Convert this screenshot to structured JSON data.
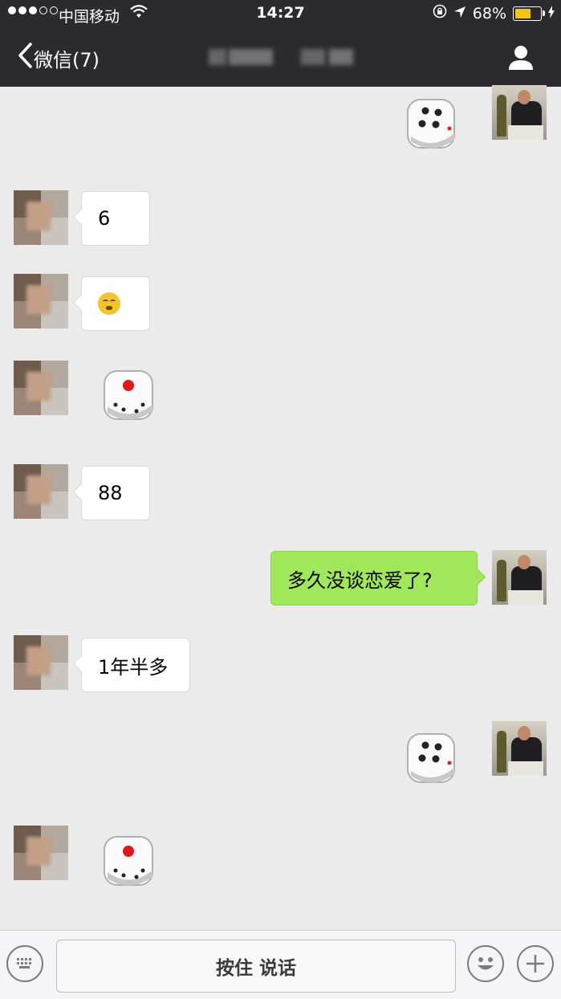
{
  "status_bar": {
    "carrier": "中国移动",
    "time": "14:27",
    "battery_percent": "68%",
    "battery_level": 0.68,
    "signal_bars": 3,
    "signal_total": 5
  },
  "nav": {
    "back_label": "微信(7)",
    "title": "",
    "contact_icon": "person-icon"
  },
  "messages": [
    {
      "side": "right",
      "type": "dice",
      "face": 4
    },
    {
      "side": "left",
      "type": "text",
      "text": "6"
    },
    {
      "side": "left",
      "type": "emoji",
      "icon": "smiling-face-emoji"
    },
    {
      "side": "left",
      "type": "dice",
      "face": 1
    },
    {
      "side": "left",
      "type": "text",
      "text": "88"
    },
    {
      "side": "right",
      "type": "text",
      "text": "多久没谈恋爱了?"
    },
    {
      "side": "left",
      "type": "text",
      "text": "1年半多"
    },
    {
      "side": "right",
      "type": "dice",
      "face": 4
    },
    {
      "side": "left",
      "type": "dice",
      "face": 1
    }
  ],
  "input_bar": {
    "hold_to_talk_label": "按住 说话",
    "keyboard_icon": "keyboard-icon",
    "emoji_icon": "emoji-icon",
    "plus_icon": "plus-icon"
  },
  "colors": {
    "nav_bg": "#2b2b2f",
    "chat_bg": "#ebebeb",
    "outgoing_bubble": "#a0e75a",
    "incoming_bubble": "#ffffff",
    "battery_fill": "#f4c21c"
  }
}
